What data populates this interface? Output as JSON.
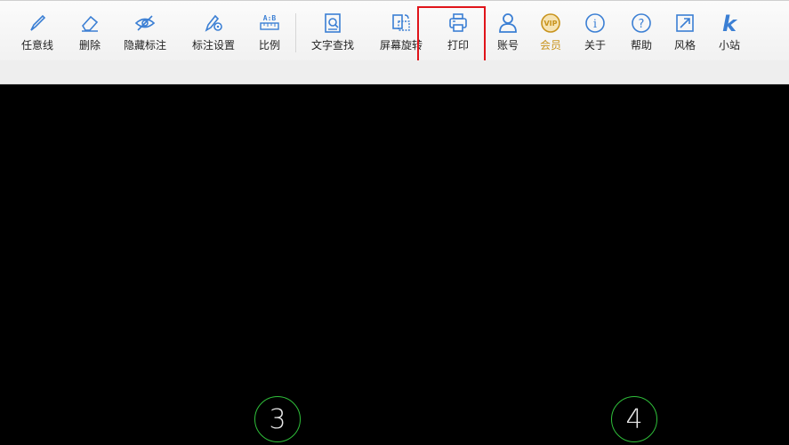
{
  "toolbar": {
    "items": [
      {
        "label": "任意线",
        "icon": "pen-icon"
      },
      {
        "label": "删除",
        "icon": "eraser-icon"
      },
      {
        "label": "隐藏标注",
        "icon": "eye-off-icon"
      },
      {
        "label": "标注设置",
        "icon": "annotation-settings-icon"
      },
      {
        "label": "比例",
        "icon": "ratio-ruler-icon"
      },
      {
        "label": "文字查找",
        "icon": "text-search-icon"
      },
      {
        "label": "屏幕旋转",
        "icon": "screen-rotate-icon"
      },
      {
        "label": "打印",
        "icon": "printer-icon"
      },
      {
        "label": "账号",
        "icon": "user-icon"
      },
      {
        "label": "会员",
        "icon": "vip-icon"
      },
      {
        "label": "关于",
        "icon": "info-icon"
      },
      {
        "label": "帮助",
        "icon": "help-icon"
      },
      {
        "label": "风格",
        "icon": "style-icon"
      },
      {
        "label": "小站",
        "icon": "site-k-icon"
      }
    ],
    "highlighted": "打印"
  },
  "canvas": {
    "axis_markers": [
      "3",
      "4"
    ]
  },
  "colors": {
    "icon_blue": "#3b7fd4",
    "vip_gold": "#c8931c",
    "highlight_red": "#e0141a",
    "canvas_bg": "#000000",
    "axis_green": "#2fbf3a"
  }
}
